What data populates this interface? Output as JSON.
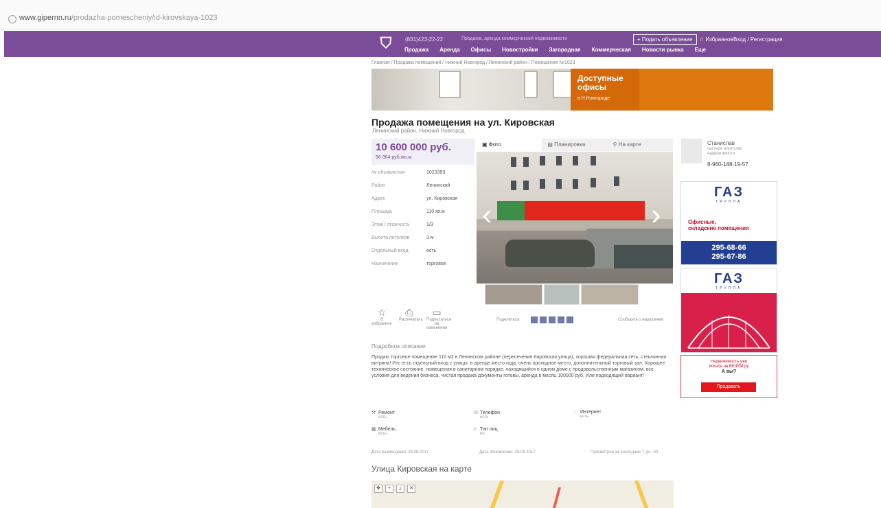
{
  "browser": {
    "url_host": "www.gipernn.ru",
    "url_path": "/prodazha-pomescheniy/id-kirovskaya-1023"
  },
  "header": {
    "phone": "(831)423-22-22",
    "tagline": "Продажа, аренда коммерческой недвижимости",
    "post_button": "+ Подать объявление",
    "favorites": "☆ Избранное",
    "login": "Вход / Регистрация",
    "nav": [
      "Продажа",
      "Аренда",
      "Офисы",
      "Новостройки",
      "Загородная",
      "Коммерческая",
      "Новости рынка",
      "Еще"
    ]
  },
  "breadcrumbs": "Главная / Продажа помещений / Нижний Новгород / Ленинский район / Помещение №1023",
  "banner": {
    "line1": "Доступные",
    "line2": "офисы",
    "line3": "в Н.Новгороде"
  },
  "listing": {
    "title": "Продажа помещения на ул. Кировская",
    "subtitle": "Ленинский район, Нижний Новгород",
    "price": "10 600 000 руб.",
    "price_per_m": "96 364 руб./кв.м",
    "properties": [
      {
        "k": "№ объявления",
        "v": "1023393"
      },
      {
        "k": "Район",
        "v": "Ленинский"
      },
      {
        "k": "Адрес",
        "v": "ул. Кировская"
      },
      {
        "k": "Площадь",
        "v": "110 кв.м"
      },
      {
        "k": "Этаж / этажность",
        "v": "1/3"
      },
      {
        "k": "Высота потолков",
        "v": "3 м"
      },
      {
        "k": "Отдельный вход",
        "v": "есть"
      },
      {
        "k": "Назначение",
        "v": "торговое"
      }
    ],
    "media_tabs": [
      "Фото",
      "Планировка",
      "На карте"
    ],
    "actions": [
      {
        "label": "В избранное",
        "icon": "star-icon"
      },
      {
        "label": "Распечатать",
        "icon": "print-icon"
      },
      {
        "label": "Подписаться на изменения",
        "icon": "subscribe-icon"
      }
    ],
    "share_label": "Поделиться:",
    "complain_label": "Сообщить о нарушении",
    "description_heading": "Подробное описание",
    "description": "Продаю торговое помещение 110 м2 в Ленинском районе (пересечение Кировская улица), хорошая федеральная сеть, стеклянная витрина! Итс есть отдельный вход с улицы, в аренде место года, очень проходное место, дополнительный торговый зал. Хорошее техническое состояние, помещения в санитарном порядке, находящийся в одном доме с продовольственным магазином, все условия для ведения бизнеса, чистая продажа документы готовы, аренда в месяц 100000 руб. Или подходящий вариант!",
    "features": [
      {
        "name": "Ремонт",
        "value": "есть",
        "icon": "hammer-icon"
      },
      {
        "name": "Телефон",
        "value": "есть",
        "icon": "phone-icon"
      },
      {
        "name": "Интернет",
        "value": "есть",
        "icon": "internet-icon"
      },
      {
        "name": "Мебель",
        "value": "есть",
        "icon": "furniture-icon"
      },
      {
        "name": "Тип лиц",
        "value": "ип",
        "icon": "check-icon"
      }
    ],
    "date_added": "Дата размещения: 28.08.2017",
    "date_updated": "Дата обновления: 28.08.2017",
    "views": "Просмотров за последние 7 дн.: 50",
    "map_heading": "Улица Кировская на карте"
  },
  "agent": {
    "name": "Станислав",
    "role": "частное агентство недвижимости",
    "phone": "8-960-188-19-57"
  },
  "ads": [
    {
      "brand": "ГАЗ",
      "brand_sub": "ГРУППА",
      "text_line1": "Офисные,",
      "text_line2": "складские помещения",
      "phone1": "295-68-66",
      "phone2": "295-67-86"
    },
    {
      "brand": "ГАЗ",
      "brand_sub": "ГРУППА"
    },
    {
      "line1": "Недвижимость уже",
      "line2": "искала на ВЕЗЁМ.ру",
      "line3": "А вы?",
      "button": "Продавать"
    }
  ],
  "colors": {
    "brand": "#7b4c97",
    "banner_orange": "#e07810",
    "ad_blue": "#233f91",
    "ad_red": "#d8204a"
  }
}
